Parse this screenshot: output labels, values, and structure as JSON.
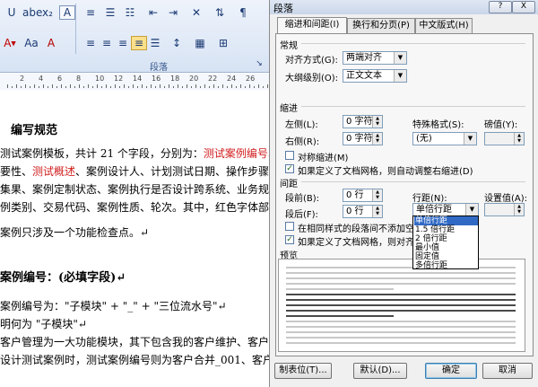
{
  "ribbon": {
    "group_label": "段落",
    "font_color_letter": "A",
    "highlight_letter": "Aa",
    "clear_letter": "A"
  },
  "ruler": {
    "numbers": [
      "2",
      "4",
      "6",
      "8",
      "10",
      "12",
      "14",
      "16",
      "18",
      "20",
      "22",
      "24",
      "26"
    ]
  },
  "document": {
    "lines": [
      {
        "text": "编写规范",
        "style": "heading"
      },
      {
        "text_parts": [
          {
            "t": "测试案例模板，共计 21 个字段，分别为：",
            "c": ""
          },
          {
            "t": "测试案例编号、需求",
            "c": "red"
          }
        ]
      },
      {
        "text_parts": [
          {
            "t": "要性、",
            "c": ""
          },
          {
            "t": "测试概述",
            "c": "red"
          },
          {
            "t": "、案例设计人、计划测试日期、操作步骤名称",
            "c": ""
          }
        ]
      },
      {
        "text": "集果、案例定制状态、案例执行是否设计跨系统、业务规则编号"
      },
      {
        "text": "例类别、交易代码、案例性质、轮次。其中，红色字体部分为"
      },
      {
        "text": "案例只涉及一个功能检查点。↵"
      },
      {
        "text": "案例编号：(必填字段)↵",
        "style": "heading"
      },
      {
        "text": "案例编号为：\"子模块\" + \"_\" + \"三位流水号\"↵"
      },
      {
        "text": "明何为 \"子模块\"↵"
      },
      {
        "text": "客户管理为一大功能模块，其下包含我的客户维护、客户合并"
      },
      {
        "text": "设计测试案例时，测试案例编号则为客户合并_001、客户分配"
      }
    ]
  },
  "dialog": {
    "title": "段落",
    "help_btn": "?",
    "close_btn": "X",
    "tabs": [
      {
        "label": "缩进和间距(I)"
      },
      {
        "label": "换行和分页(P)"
      },
      {
        "label": "中文版式(H)"
      }
    ],
    "general": {
      "title": "常规",
      "alignment_label": "对齐方式(G):",
      "alignment_value": "两端对齐",
      "outline_label": "大纲级别(O):",
      "outline_value": "正文文本"
    },
    "indent": {
      "title": "缩进",
      "left_label": "左侧(L):",
      "left_value": "0 字符",
      "right_label": "右侧(R):",
      "right_value": "0 字符",
      "special_label": "特殊格式(S):",
      "special_value": "(无)",
      "by_label": "磅值(Y):",
      "mirror_label": "对称缩进(M)",
      "mirror_checked": false,
      "autoadjust_label": "如果定义了文档网格，则自动调整右缩进(D)",
      "autoadjust_checked": true
    },
    "spacing": {
      "title": "间距",
      "before_label": "段前(B):",
      "before_value": "0 行",
      "after_label": "段后(F):",
      "after_value": "0 行",
      "line_label": "行距(N):",
      "line_value": "单倍行距",
      "at_label": "设置值(A):",
      "nospace_label": "在相同样式的段落间不添加空格",
      "nospace_checked": false,
      "snap_label": "如果定义了文档网格，则对齐到",
      "snap_checked": true,
      "options": [
        "单倍行距",
        "1.5 倍行距",
        "2 倍行距",
        "最小值",
        "固定值",
        "多倍行距"
      ],
      "selected_index": 0
    },
    "preview": {
      "title": "预览"
    },
    "buttons": {
      "tabs": "制表位(T)...",
      "default": "默认(D)...",
      "ok": "确定",
      "cancel": "取消"
    }
  }
}
